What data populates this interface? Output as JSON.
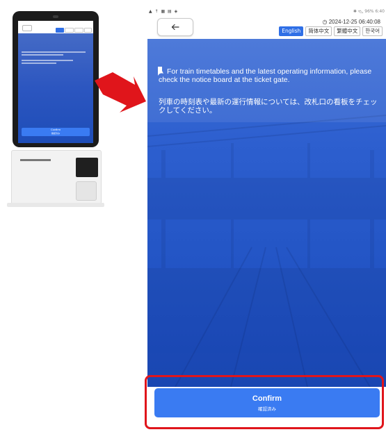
{
  "status_bar": {
    "left_icons": "▲ ↑ ▦ ▤ ◈",
    "right_text": "✱ ▿◺ 96% 6:40"
  },
  "header": {
    "back_icon": "arrow-left-icon",
    "datetime": "◷ 2024-12-25 06:40:08",
    "languages": [
      {
        "label": "English",
        "active": true
      },
      {
        "label": "简体中文",
        "active": false
      },
      {
        "label": "繁體中文",
        "active": false
      },
      {
        "label": "한국어",
        "active": false
      }
    ]
  },
  "notice": {
    "text_en": "For train timetables and the latest operating information, please check the notice board at the ticket gate.",
    "text_ja": "列車の時刻表や最新の運行情報については、改札口の看板をチェックしてください。"
  },
  "confirm": {
    "label": "Confirm",
    "sublabel": "確認済み"
  },
  "kiosk_thumbnail": {
    "confirm_label": "Confirm",
    "confirm_sublabel": "確認済み"
  },
  "colors": {
    "accent": "#3a7bf2",
    "highlight": "#e0151b",
    "arrow": "#e0151b",
    "background_blue": "#2456c6"
  }
}
